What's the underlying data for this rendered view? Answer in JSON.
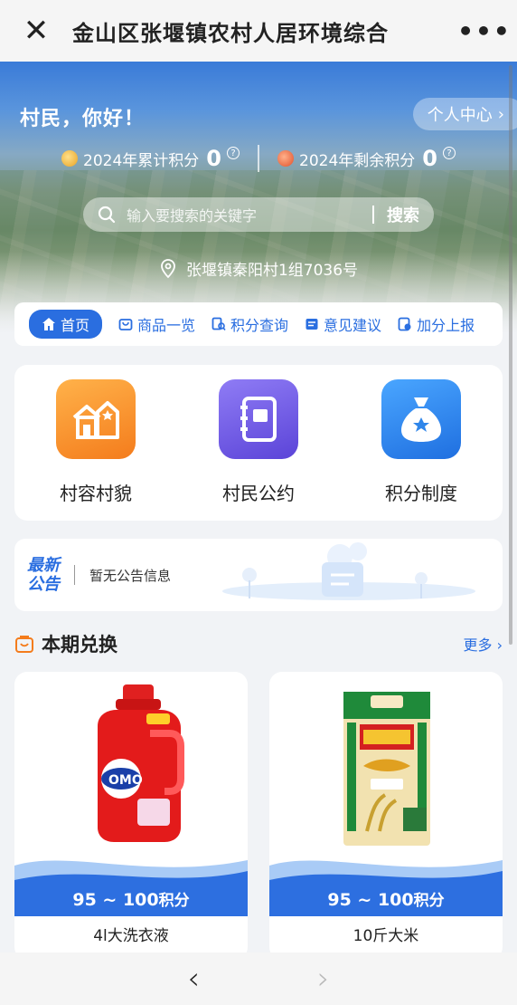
{
  "topbar": {
    "title": "金山区张堰镇农村人居环境综合",
    "close_icon": "close-icon",
    "more_icon": "more-dots-icon"
  },
  "hero": {
    "greeting": "村民，你好！",
    "user_center": "个人中心",
    "cumulative_label": "2024年累计积分",
    "cumulative_value": "0",
    "remaining_label": "2024年剩余积分",
    "remaining_value": "0",
    "search_placeholder": "输入要搜索的关键字",
    "search_button": "搜索",
    "address": "张堰镇秦阳村1组7036号"
  },
  "nav": {
    "tabs": [
      {
        "label": "首页",
        "icon": "home-icon",
        "active": true
      },
      {
        "label": "商品一览",
        "icon": "shop-icon"
      },
      {
        "label": "积分查询",
        "icon": "points-query-icon"
      },
      {
        "label": "意见建议",
        "icon": "feedback-icon"
      },
      {
        "label": "加分上报",
        "icon": "report-icon"
      }
    ]
  },
  "features": [
    {
      "label": "村容村貌",
      "icon": "village-icon",
      "color": "#f7942b"
    },
    {
      "label": "村民公约",
      "icon": "notebook-icon",
      "color": "#6b57e0"
    },
    {
      "label": "积分制度",
      "icon": "money-bag-icon",
      "color": "#2f86ea"
    }
  ],
  "notice": {
    "tag_line1": "最新",
    "tag_line2": "公告",
    "text": "暂无公告信息"
  },
  "exchange": {
    "title": "本期兑换",
    "more": "更多",
    "products": [
      {
        "name": "4l大洗衣液",
        "price": "95 ~ 100",
        "unit": "积分"
      },
      {
        "name": "10斤大米",
        "price": "95 ~ 100",
        "unit": "积分"
      }
    ]
  },
  "bottom": {
    "back_icon": "back-arrow-icon",
    "forward_icon": "forward-arrow-icon"
  },
  "colors": {
    "primary": "#2a6ee0",
    "wave": "#2d6fe0"
  }
}
